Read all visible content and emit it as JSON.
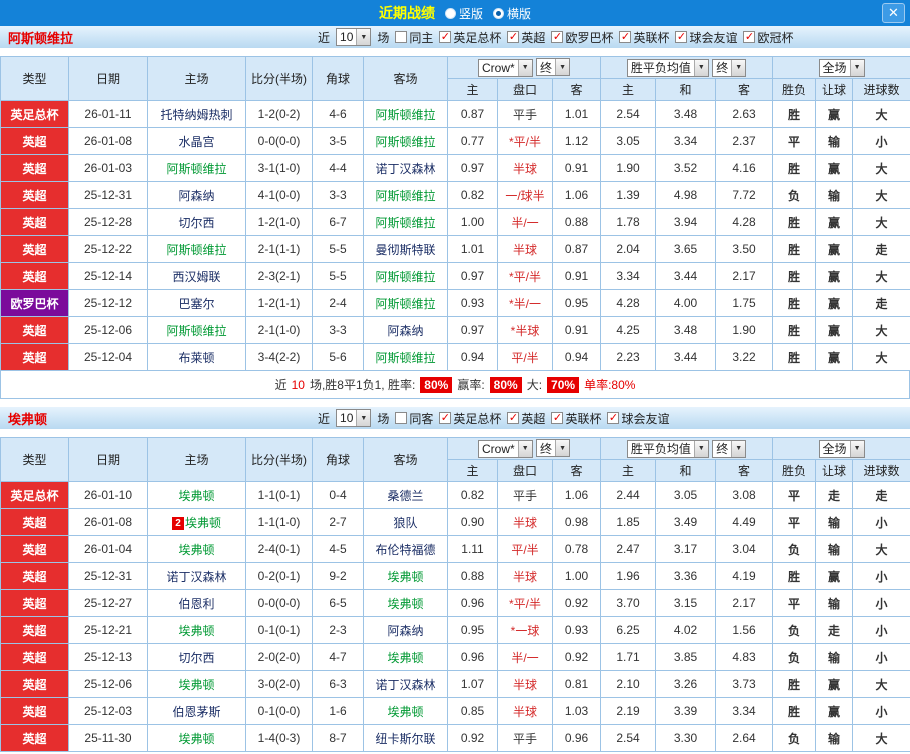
{
  "topbar": {
    "title": "近期战绩",
    "radio_vertical": "竖版",
    "radio_horizontal": "横版",
    "selected": "横版",
    "close_label": "✕"
  },
  "colors": {
    "accent_blue": "#1482d8",
    "league_red": "#e62e2e",
    "league_purple": "#7b0b9b",
    "focal_team_green": "#009933",
    "win_red": "#e60000",
    "draw_blue": "#0014cc",
    "lose_green": "#008a00"
  },
  "filter_common": {
    "recent_prefix": "近",
    "recent_value": "10",
    "recent_suffix": "场"
  },
  "table_header": {
    "type": "类型",
    "date": "日期",
    "home": "主场",
    "score": "比分(半场)",
    "corner": "角球",
    "away": "客场",
    "dd_company": "Crow*",
    "dd_final_a": "终",
    "dd_avg": "胜平负均值",
    "dd_final_b": "终",
    "dd_scope": "全场",
    "ah_home": "主",
    "ah_line": "盘口",
    "ah_away": "客",
    "eu_home": "主",
    "eu_draw": "和",
    "eu_away": "客",
    "result": "胜负",
    "handicap": "让球",
    "goals": "进球数"
  },
  "sections": [
    {
      "team": "阿斯顿维拉",
      "checkboxes": [
        {
          "label": "同主",
          "checked": false
        },
        {
          "label": "英足总杯",
          "checked": true
        },
        {
          "label": "英超",
          "checked": true
        },
        {
          "label": "欧罗巴杯",
          "checked": true
        },
        {
          "label": "英联杯",
          "checked": true
        },
        {
          "label": "球会友谊",
          "checked": true
        },
        {
          "label": "欧冠杯",
          "checked": true
        }
      ],
      "rows": [
        {
          "league": "英足总杯",
          "date": "26-01-11",
          "home": "托特纳姆热刺",
          "score": "1-2(0-2)",
          "corner": "4-6",
          "away": "阿斯顿维拉",
          "away_focal": true,
          "ah_home": "0.87",
          "ah_line": "平手",
          "ah_away": "1.01",
          "eu_home": "2.54",
          "eu_draw": "3.48",
          "eu_away": "2.63",
          "result": "胜",
          "handicap": "赢",
          "goals": "大"
        },
        {
          "league": "英超",
          "date": "26-01-08",
          "home": "水晶宫",
          "score": "0-0(0-0)",
          "corner": "3-5",
          "away": "阿斯顿维拉",
          "away_focal": true,
          "ah_home": "0.77",
          "ah_line": "*平/半",
          "ah_away": "1.12",
          "eu_home": "3.05",
          "eu_draw": "3.34",
          "eu_away": "2.37",
          "result": "平",
          "handicap": "输",
          "goals": "小"
        },
        {
          "league": "英超",
          "date": "26-01-03",
          "home": "阿斯顿维拉",
          "home_focal": true,
          "score": "3-1(1-0)",
          "corner": "4-4",
          "away": "诺丁汉森林",
          "ah_home": "0.97",
          "ah_line": "半球",
          "ah_away": "0.91",
          "eu_home": "1.90",
          "eu_draw": "3.52",
          "eu_away": "4.16",
          "result": "胜",
          "handicap": "赢",
          "goals": "大"
        },
        {
          "league": "英超",
          "date": "25-12-31",
          "home": "阿森纳",
          "score": "4-1(0-0)",
          "corner": "3-3",
          "away": "阿斯顿维拉",
          "away_focal": true,
          "ah_home": "0.82",
          "ah_line": "一/球半",
          "ah_away": "1.06",
          "eu_home": "1.39",
          "eu_draw": "4.98",
          "eu_away": "7.72",
          "result": "负",
          "handicap": "输",
          "goals": "大"
        },
        {
          "league": "英超",
          "date": "25-12-28",
          "home": "切尔西",
          "score": "1-2(1-0)",
          "corner": "6-7",
          "away": "阿斯顿维拉",
          "away_focal": true,
          "ah_home": "1.00",
          "ah_line": "半/一",
          "ah_away": "0.88",
          "eu_home": "1.78",
          "eu_draw": "3.94",
          "eu_away": "4.28",
          "result": "胜",
          "handicap": "赢",
          "goals": "大"
        },
        {
          "league": "英超",
          "date": "25-12-22",
          "home": "阿斯顿维拉",
          "home_focal": true,
          "score": "2-1(1-1)",
          "corner": "5-5",
          "away": "曼彻斯特联",
          "ah_home": "1.01",
          "ah_line": "半球",
          "ah_away": "0.87",
          "eu_home": "2.04",
          "eu_draw": "3.65",
          "eu_away": "3.50",
          "result": "胜",
          "handicap": "赢",
          "goals": "走"
        },
        {
          "league": "英超",
          "date": "25-12-14",
          "home": "西汉姆联",
          "score": "2-3(2-1)",
          "corner": "5-5",
          "away": "阿斯顿维拉",
          "away_focal": true,
          "ah_home": "0.97",
          "ah_line": "*平/半",
          "ah_away": "0.91",
          "eu_home": "3.34",
          "eu_draw": "3.44",
          "eu_away": "2.17",
          "result": "胜",
          "handicap": "赢",
          "goals": "大"
        },
        {
          "league": "欧罗巴杯",
          "league_color": "purple",
          "date": "25-12-12",
          "home": "巴塞尔",
          "score": "1-2(1-1)",
          "corner": "2-4",
          "away": "阿斯顿维拉",
          "away_focal": true,
          "ah_home": "0.93",
          "ah_line": "*半/一",
          "ah_away": "0.95",
          "eu_home": "4.28",
          "eu_draw": "4.00",
          "eu_away": "1.75",
          "result": "胜",
          "handicap": "赢",
          "goals": "走"
        },
        {
          "league": "英超",
          "date": "25-12-06",
          "home": "阿斯顿维拉",
          "home_focal": true,
          "score": "2-1(1-0)",
          "corner": "3-3",
          "away": "阿森纳",
          "ah_home": "0.97",
          "ah_line": "*半球",
          "ah_away": "0.91",
          "eu_home": "4.25",
          "eu_draw": "3.48",
          "eu_away": "1.90",
          "result": "胜",
          "handicap": "赢",
          "goals": "大"
        },
        {
          "league": "英超",
          "date": "25-12-04",
          "home": "布莱顿",
          "score": "3-4(2-2)",
          "corner": "5-6",
          "away": "阿斯顿维拉",
          "away_focal": true,
          "ah_home": "0.94",
          "ah_line": "平/半",
          "ah_away": "0.94",
          "eu_home": "2.23",
          "eu_draw": "3.44",
          "eu_away": "3.22",
          "result": "胜",
          "handicap": "赢",
          "goals": "大"
        }
      ],
      "summary": {
        "pre": "近",
        "count": "10",
        "mid": "场,胜8平1负1, 胜率:",
        "win_rate": "80%",
        "label2": "赢率:",
        "handicap_rate": "80%",
        "label3": "大:",
        "big_rate": "70%",
        "tail": "单率:80%"
      }
    },
    {
      "team": "埃弗顿",
      "checkboxes": [
        {
          "label": "同客",
          "checked": false
        },
        {
          "label": "英足总杯",
          "checked": true
        },
        {
          "label": "英超",
          "checked": true
        },
        {
          "label": "英联杯",
          "checked": true
        },
        {
          "label": "球会友谊",
          "checked": true
        }
      ],
      "rows": [
        {
          "league": "英足总杯",
          "date": "26-01-10",
          "home": "埃弗顿",
          "home_focal": true,
          "score": "1-1(0-1)",
          "corner": "0-4",
          "away": "桑德兰",
          "ah_home": "0.82",
          "ah_line": "平手",
          "ah_away": "1.06",
          "eu_home": "2.44",
          "eu_draw": "3.05",
          "eu_away": "3.08",
          "result": "平",
          "handicap": "走",
          "goals": "走"
        },
        {
          "league": "英超",
          "date": "26-01-08",
          "home": "埃弗顿",
          "home_focal": true,
          "home_badge": "2",
          "score": "1-1(1-0)",
          "corner": "2-7",
          "away": "狼队",
          "ah_home": "0.90",
          "ah_line": "半球",
          "ah_away": "0.98",
          "eu_home": "1.85",
          "eu_draw": "3.49",
          "eu_away": "4.49",
          "result": "平",
          "handicap": "输",
          "goals": "小"
        },
        {
          "league": "英超",
          "date": "26-01-04",
          "home": "埃弗顿",
          "home_focal": true,
          "score": "2-4(0-1)",
          "corner": "4-5",
          "away": "布伦特福德",
          "ah_home": "1.11",
          "ah_line": "平/半",
          "ah_away": "0.78",
          "eu_home": "2.47",
          "eu_draw": "3.17",
          "eu_away": "3.04",
          "result": "负",
          "handicap": "输",
          "goals": "大"
        },
        {
          "league": "英超",
          "date": "25-12-31",
          "home": "诺丁汉森林",
          "score": "0-2(0-1)",
          "corner": "9-2",
          "away": "埃弗顿",
          "away_focal": true,
          "ah_home": "0.88",
          "ah_line": "半球",
          "ah_away": "1.00",
          "eu_home": "1.96",
          "eu_draw": "3.36",
          "eu_away": "4.19",
          "result": "胜",
          "handicap": "赢",
          "goals": "小"
        },
        {
          "league": "英超",
          "date": "25-12-27",
          "home": "伯恩利",
          "score": "0-0(0-0)",
          "corner": "6-5",
          "away": "埃弗顿",
          "away_focal": true,
          "ah_home": "0.96",
          "ah_line": "*平/半",
          "ah_away": "0.92",
          "eu_home": "3.70",
          "eu_draw": "3.15",
          "eu_away": "2.17",
          "result": "平",
          "handicap": "输",
          "goals": "小"
        },
        {
          "league": "英超",
          "date": "25-12-21",
          "home": "埃弗顿",
          "home_focal": true,
          "score": "0-1(0-1)",
          "corner": "2-3",
          "away": "阿森纳",
          "ah_home": "0.95",
          "ah_line": "*一球",
          "ah_away": "0.93",
          "eu_home": "6.25",
          "eu_draw": "4.02",
          "eu_away": "1.56",
          "result": "负",
          "handicap": "走",
          "goals": "小"
        },
        {
          "league": "英超",
          "date": "25-12-13",
          "home": "切尔西",
          "score": "2-0(2-0)",
          "corner": "4-7",
          "away": "埃弗顿",
          "away_focal": true,
          "ah_home": "0.96",
          "ah_line": "半/一",
          "ah_away": "0.92",
          "eu_home": "1.71",
          "eu_draw": "3.85",
          "eu_away": "4.83",
          "result": "负",
          "handicap": "输",
          "goals": "小"
        },
        {
          "league": "英超",
          "date": "25-12-06",
          "home": "埃弗顿",
          "home_focal": true,
          "score": "3-0(2-0)",
          "corner": "6-3",
          "away": "诺丁汉森林",
          "ah_home": "1.07",
          "ah_line": "半球",
          "ah_away": "0.81",
          "eu_home": "2.10",
          "eu_draw": "3.26",
          "eu_away": "3.73",
          "result": "胜",
          "handicap": "赢",
          "goals": "大"
        },
        {
          "league": "英超",
          "date": "25-12-03",
          "home": "伯恩茅斯",
          "score": "0-1(0-0)",
          "corner": "1-6",
          "away": "埃弗顿",
          "away_focal": true,
          "ah_home": "0.85",
          "ah_line": "半球",
          "ah_away": "1.03",
          "eu_home": "2.19",
          "eu_draw": "3.39",
          "eu_away": "3.34",
          "result": "胜",
          "handicap": "赢",
          "goals": "小"
        },
        {
          "league": "英超",
          "date": "25-11-30",
          "home": "埃弗顿",
          "home_focal": true,
          "score": "1-4(0-3)",
          "corner": "8-7",
          "away": "纽卡斯尔联",
          "ah_home": "0.92",
          "ah_line": "平手",
          "ah_away": "0.96",
          "eu_home": "2.54",
          "eu_draw": "3.30",
          "eu_away": "2.64",
          "result": "负",
          "handicap": "输",
          "goals": "大"
        }
      ]
    }
  ]
}
